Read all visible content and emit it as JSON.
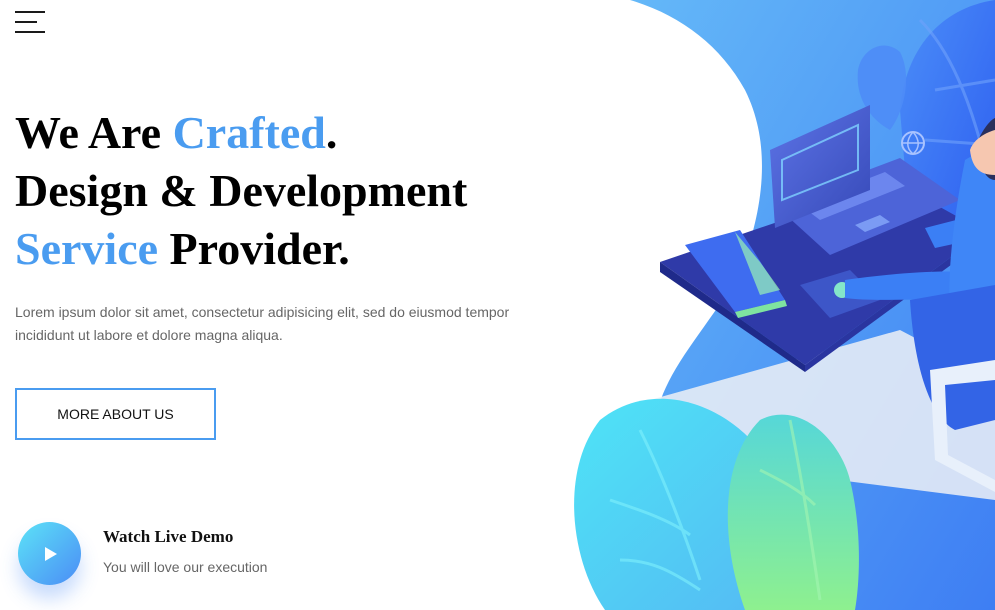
{
  "header": {
    "menu_icon": "hamburger-menu-icon"
  },
  "hero": {
    "headline": {
      "line1_a": "We Are ",
      "line1_accent": "Crafted",
      "line1_b": ".",
      "line2": "Design & Development",
      "line3_accent": "Service",
      "line3_b": " Provider."
    },
    "description": "Lorem ipsum dolor sit amet, consectetur adipisicing elit, sed do eiusmod tempor incididunt ut labore et dolore magna aliqua.",
    "cta_label": "MORE ABOUT US"
  },
  "demo": {
    "play_icon": "play-icon",
    "title": "Watch Live Demo",
    "subtitle": "You will love our execution"
  },
  "colors": {
    "accent": "#4a9cf0",
    "illustration_blue": "#3f8ef5",
    "illustration_cyan": "#4fe3f6",
    "illustration_green": "#86ec9c",
    "illustration_navy": "#2e3a9e"
  }
}
